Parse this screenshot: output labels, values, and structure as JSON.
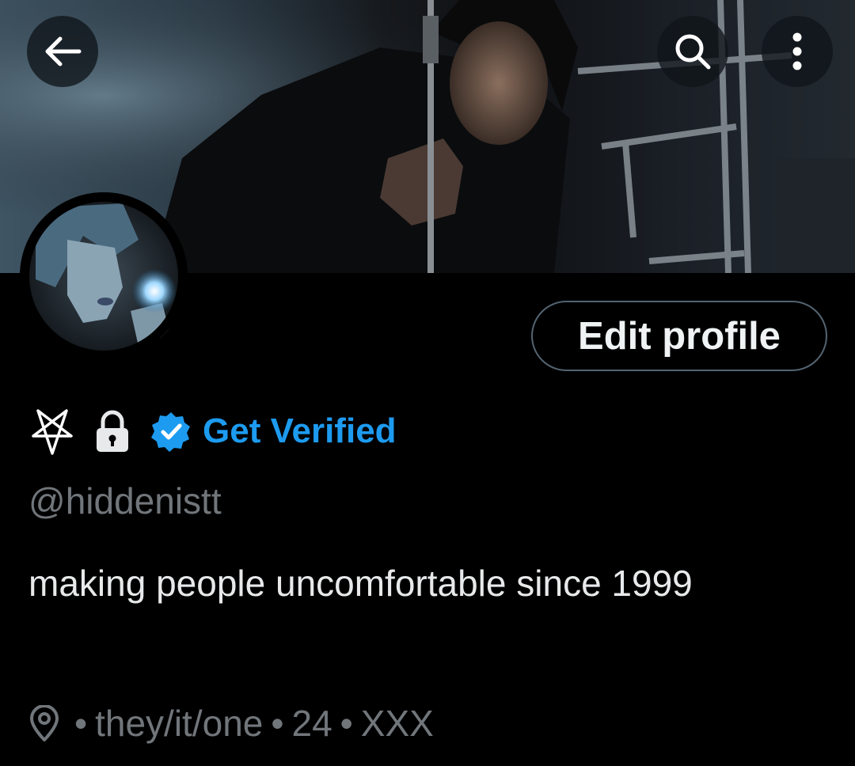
{
  "header": {
    "back_icon": "arrow-left-icon",
    "search_icon": "search-icon",
    "more_icon": "more-vertical-icon"
  },
  "profile": {
    "edit_button_label": "Edit profile",
    "name_icons": [
      "pentagram-icon",
      "lock-icon"
    ],
    "verified_badge_icon": "verified-badge-icon",
    "get_verified_label": "Get Verified",
    "handle": "@hiddenistt",
    "bio": "making people uncomfortable since 1999",
    "location_icon": "location-pin-icon",
    "meta_items": [
      "•",
      "they/it/one",
      "•",
      "24",
      "•",
      "XXX"
    ]
  },
  "colors": {
    "background": "#000000",
    "accent": "#1d9bf0",
    "secondary_text": "#71767b",
    "primary_text": "#e7e9ea",
    "button_border": "#536471"
  }
}
